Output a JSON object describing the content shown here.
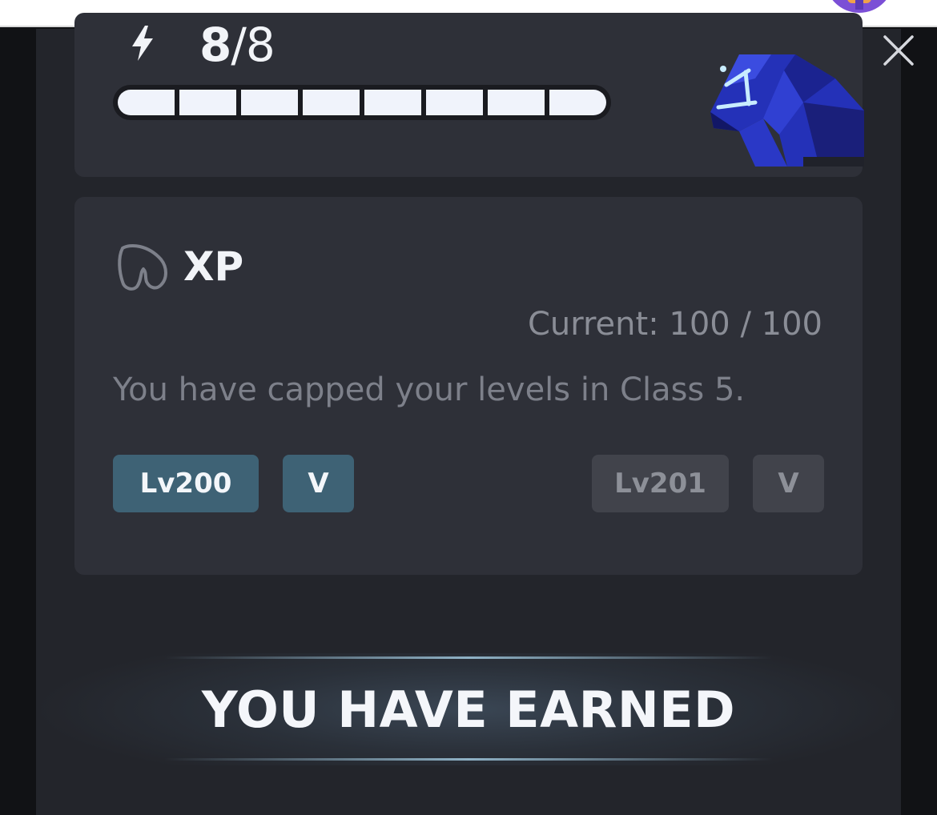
{
  "energy": {
    "current": "8",
    "separator": "/",
    "max": "8",
    "segments_filled": 8,
    "segments_total": 8,
    "icon": "lightning-icon"
  },
  "xp": {
    "title": "XP",
    "icon": "horse-head-icon",
    "current_label": "Current: 100 / 100",
    "message": "You have capped your levels in Class 5.",
    "current_level": "Lv200",
    "current_class": "V",
    "next_level": "Lv201",
    "next_class": "V",
    "progress_fraction": 1.0
  },
  "earned": {
    "heading": "YOU HAVE EARNED"
  },
  "close": {
    "icon": "close-icon"
  },
  "colors": {
    "accent_chip": "#3e6275",
    "disabled_chip": "#41434b",
    "horse_blue": "#2431b8",
    "avatar_purple": "#7b4fd6"
  }
}
